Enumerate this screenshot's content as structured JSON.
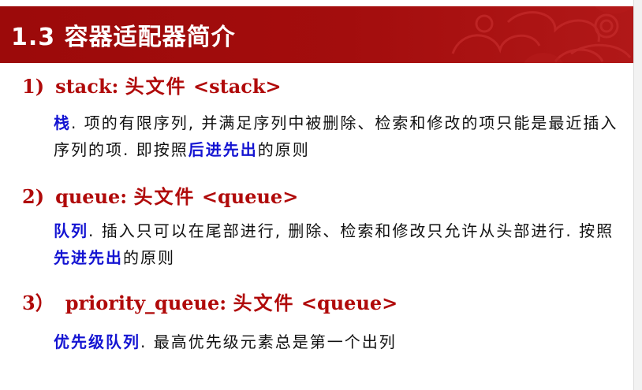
{
  "header": {
    "title": "1.3 容器适配器简介",
    "background_color": "#a30d0d",
    "decoration": "cloud-pattern-icon"
  },
  "sections": [
    {
      "number": "1)",
      "name": "stack:",
      "header_label": "头文件",
      "header_file": "<stack>",
      "text_parts": [
        "栈",
        ". 项的有限序列, 并满足序列中被删除、检索和修改的项只能是最近插入序列的项. 即按照",
        "后进先出",
        "的原则"
      ]
    },
    {
      "number": "2)",
      "name": "queue:",
      "header_label": "头文件",
      "header_file": "<queue>",
      "text_parts": [
        "队列",
        ". 插入只可以在尾部进行, 删除、检索和修改只允许从头部进行. 按照",
        "先进先出",
        "的原则"
      ]
    },
    {
      "number": "3）",
      "name": "priority_queue:",
      "header_label": "头文件",
      "header_file": "<queue>",
      "text_parts": [
        "优先级队列",
        ". 最高优先级元素总是第一个出列"
      ]
    }
  ],
  "colors": {
    "heading": "#b00a0a",
    "highlight": "#1414d2",
    "text": "#111111"
  }
}
